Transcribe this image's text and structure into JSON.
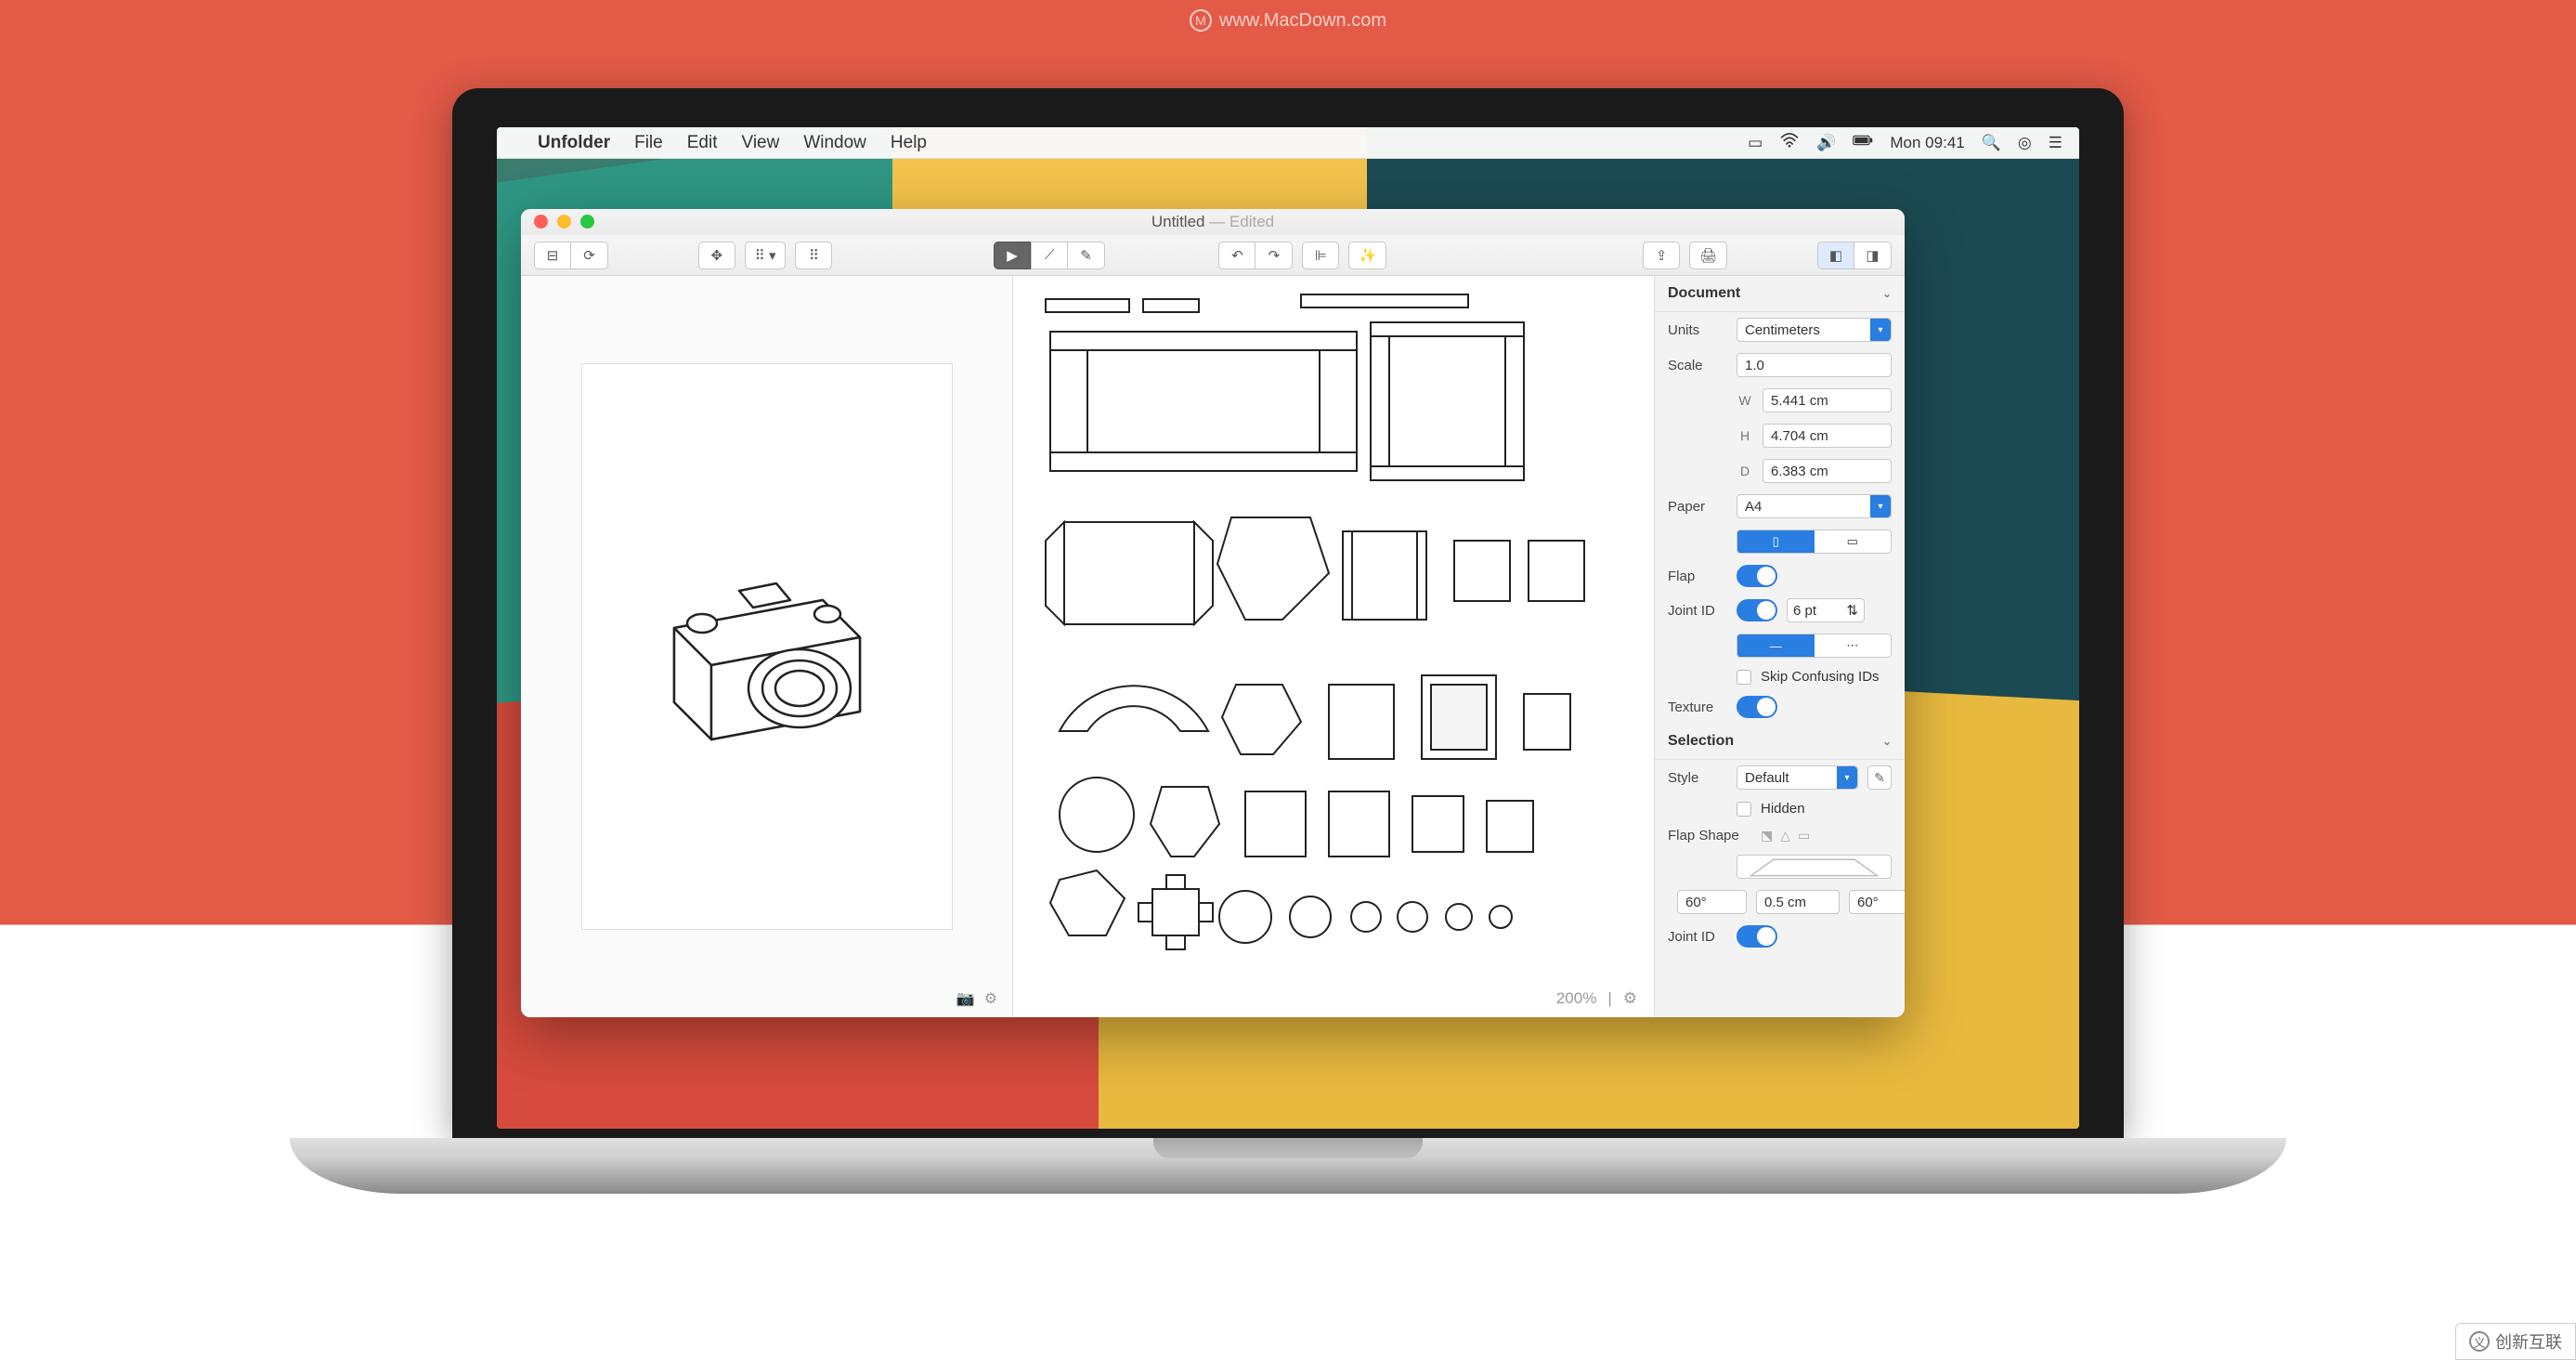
{
  "watermark": "www.MacDown.com",
  "corner_badge": "创新互联",
  "menubar": {
    "app": "Unfolder",
    "items": [
      "File",
      "Edit",
      "View",
      "Window",
      "Help"
    ],
    "clock": "Mon 09:41"
  },
  "window": {
    "title": "Untitled",
    "subtitle": " — Edited"
  },
  "canvas2d": {
    "zoom": "200%"
  },
  "inspector": {
    "document": {
      "header": "Document",
      "units_label": "Units",
      "units_value": "Centimeters",
      "scale_label": "Scale",
      "scale_value": "1.0",
      "w_label": "W",
      "w_value": "5.441 cm",
      "h_label": "H",
      "h_value": "4.704 cm",
      "d_label": "D",
      "d_value": "6.383 cm",
      "paper_label": "Paper",
      "paper_value": "A4",
      "flap_label": "Flap",
      "jointid_label": "Joint ID",
      "jointid_value": "6 pt",
      "skip_label": "Skip Confusing IDs",
      "texture_label": "Texture"
    },
    "selection": {
      "header": "Selection",
      "style_label": "Style",
      "style_value": "Default",
      "hidden_label": "Hidden",
      "flapshape_label": "Flap Shape",
      "angle_left": "60°",
      "length": "0.5 cm",
      "angle_right": "60°",
      "jointid_label": "Joint ID"
    }
  }
}
